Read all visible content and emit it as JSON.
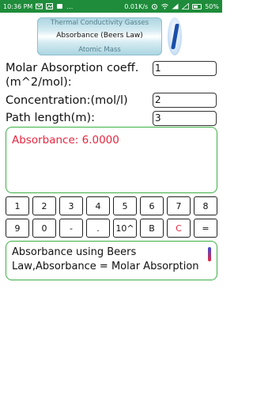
{
  "status_bar": {
    "time": "10:36 PM",
    "speed": "0.01K/s",
    "battery": "50%",
    "accent_color": "#1e8c3a"
  },
  "picker": {
    "prev": "Thermal Conductivity Gasses",
    "selected": "Absorbance (Beers Law)",
    "next": "Atomic Mass"
  },
  "info_icon": "info-icon",
  "inputs": [
    {
      "label_line1": "Molar Absorption coeff.",
      "label_line2": "(m^2/mol):",
      "value": "1"
    },
    {
      "label": "Concentration:(mol/l)",
      "value": "2"
    },
    {
      "label": "Path length(m):",
      "value": "3"
    }
  ],
  "result": {
    "text": "Absorbance: 6.0000",
    "color": "#e8263f"
  },
  "keypad": {
    "row1": [
      "1",
      "2",
      "3",
      "4",
      "5",
      "6",
      "7",
      "8"
    ],
    "row2": [
      "9",
      "0",
      "-",
      ".",
      "10^",
      "B",
      "C",
      "="
    ]
  },
  "description": "Absorbance using Beers Law,Absorbance = Molar Absorption"
}
